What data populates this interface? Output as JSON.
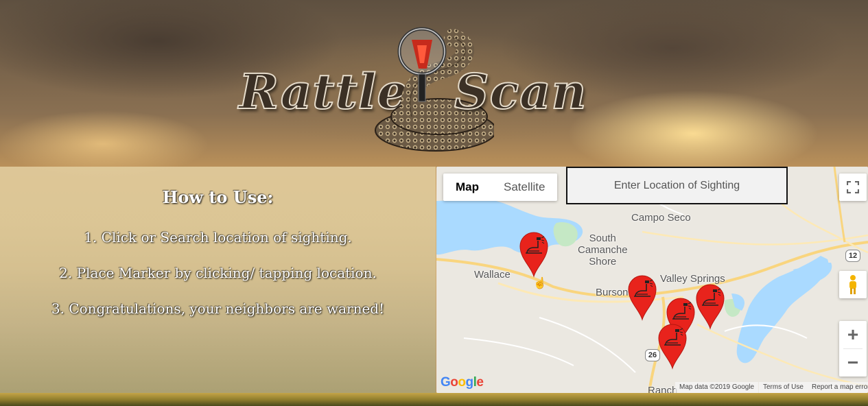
{
  "app": {
    "logo_word_1": "Rattle",
    "logo_word_2": "Scan"
  },
  "instructions": {
    "title": "How to Use:",
    "steps": [
      "1. Click or Search location of sighting.",
      "2. Place Marker by clicking/ tapping location.",
      "3. Congratulations, your neighbors are warned!"
    ]
  },
  "map": {
    "type_buttons": [
      "Map",
      "Satellite"
    ],
    "active_type": "Map",
    "search_placeholder": "Enter Location of Sighting",
    "places": {
      "campo_seco": "Campo Seco",
      "south_camanche_shore": "South\nCamanche\nShore",
      "wallace": "Wallace",
      "valley_springs": "Valley Springs",
      "burson": "Burson",
      "rancho": "Ranch"
    },
    "route_shields": [
      "12",
      "26"
    ],
    "google_logo": "Google",
    "attribution": {
      "map_data": "Map data ©2019 Google",
      "terms": "Terms of Use",
      "report": "Report a map error"
    },
    "marker_count": 5,
    "colors": {
      "marker": "#e8231c",
      "water": "#aadaff",
      "park": "#c5e8c5",
      "road": "#f9d57e"
    }
  }
}
